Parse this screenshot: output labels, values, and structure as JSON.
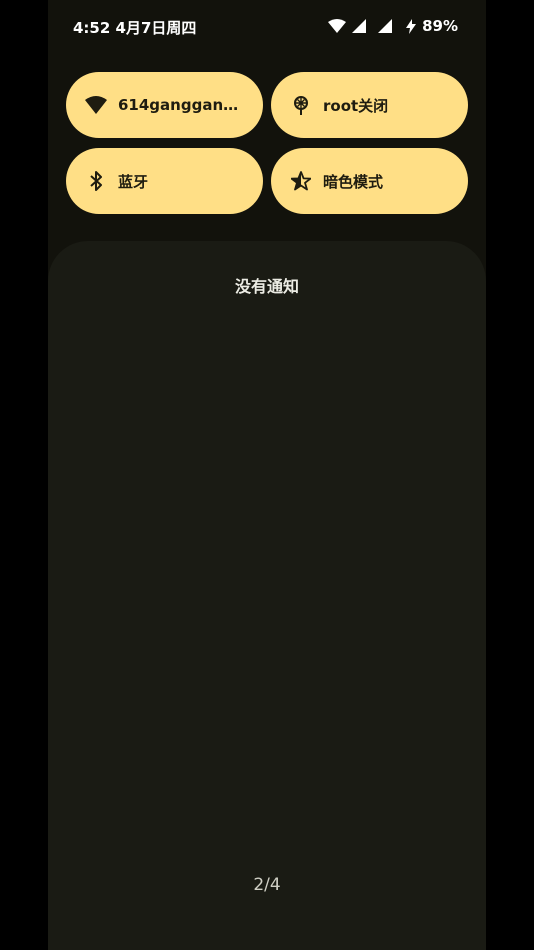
{
  "status_bar": {
    "time": "4:52",
    "date": "4月7日周四",
    "battery": "89%"
  },
  "quick_settings": {
    "tiles": [
      {
        "label": "614ganggang_...",
        "icon": "wifi-icon"
      },
      {
        "label": "root关闭",
        "icon": "root-icon"
      },
      {
        "label": "蓝牙",
        "icon": "bluetooth-icon"
      },
      {
        "label": "暗色模式",
        "icon": "dark-mode-icon"
      }
    ]
  },
  "notifications": {
    "empty_text": "没有通知",
    "page_indicator": "2/4"
  },
  "colors": {
    "tile_bg": "#ffdf86",
    "panel_bg": "#1a1b14",
    "screen_bg": "#12120c"
  }
}
